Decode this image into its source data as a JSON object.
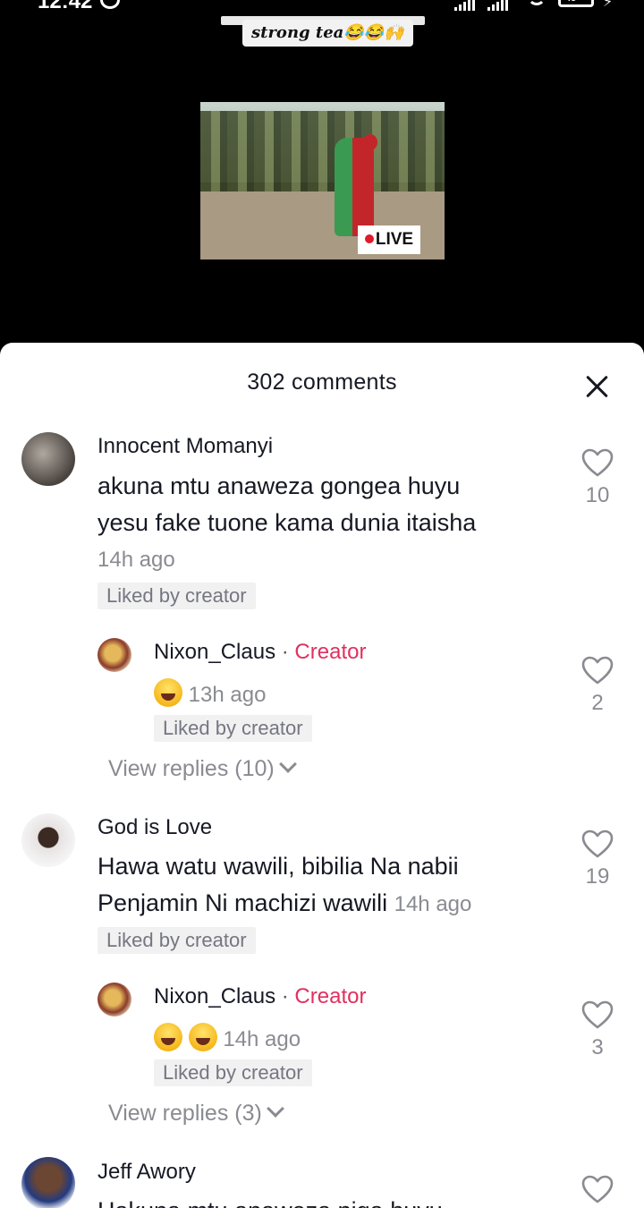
{
  "status_bar": {
    "time": "12:42",
    "battery": "45"
  },
  "video": {
    "caption": "strong tea😂😂🙌",
    "live_badge": "LIVE"
  },
  "sheet": {
    "title": "302 comments"
  },
  "comments": [
    {
      "username": "Innocent Momanyi",
      "text_line1": "akuna mtu anaweza gongea huyu",
      "text_line2": "yesu fake tuone kama dunia itaisha",
      "timestamp": "14h ago",
      "liked_by_creator": "Liked by creator",
      "likes": "10",
      "reply": {
        "username": "Nixon_Claus",
        "separator": "·",
        "badge": "Creator",
        "timestamp": "13h ago",
        "liked_by_creator": "Liked by creator",
        "likes": "2"
      },
      "view_replies": "View replies (10)"
    },
    {
      "username": "God is Love",
      "text_line1": "Hawa watu wawili, bibilia Na nabii",
      "text_line2": "Penjamin Ni machizi wawili",
      "timestamp": "14h ago",
      "liked_by_creator": "Liked by creator",
      "likes": "19",
      "reply": {
        "username": "Nixon_Claus",
        "separator": "·",
        "badge": "Creator",
        "timestamp": "14h ago",
        "liked_by_creator": "Liked by creator",
        "likes": "3"
      },
      "view_replies": "View replies (3)"
    },
    {
      "username": "Jeff Awory",
      "text_line1": "Hakuna mtu anaweza piga huyu"
    }
  ],
  "colors": {
    "creator_badge": "#e1305f",
    "muted_text": "#8a8b91",
    "live_dot": "#e0192d"
  }
}
